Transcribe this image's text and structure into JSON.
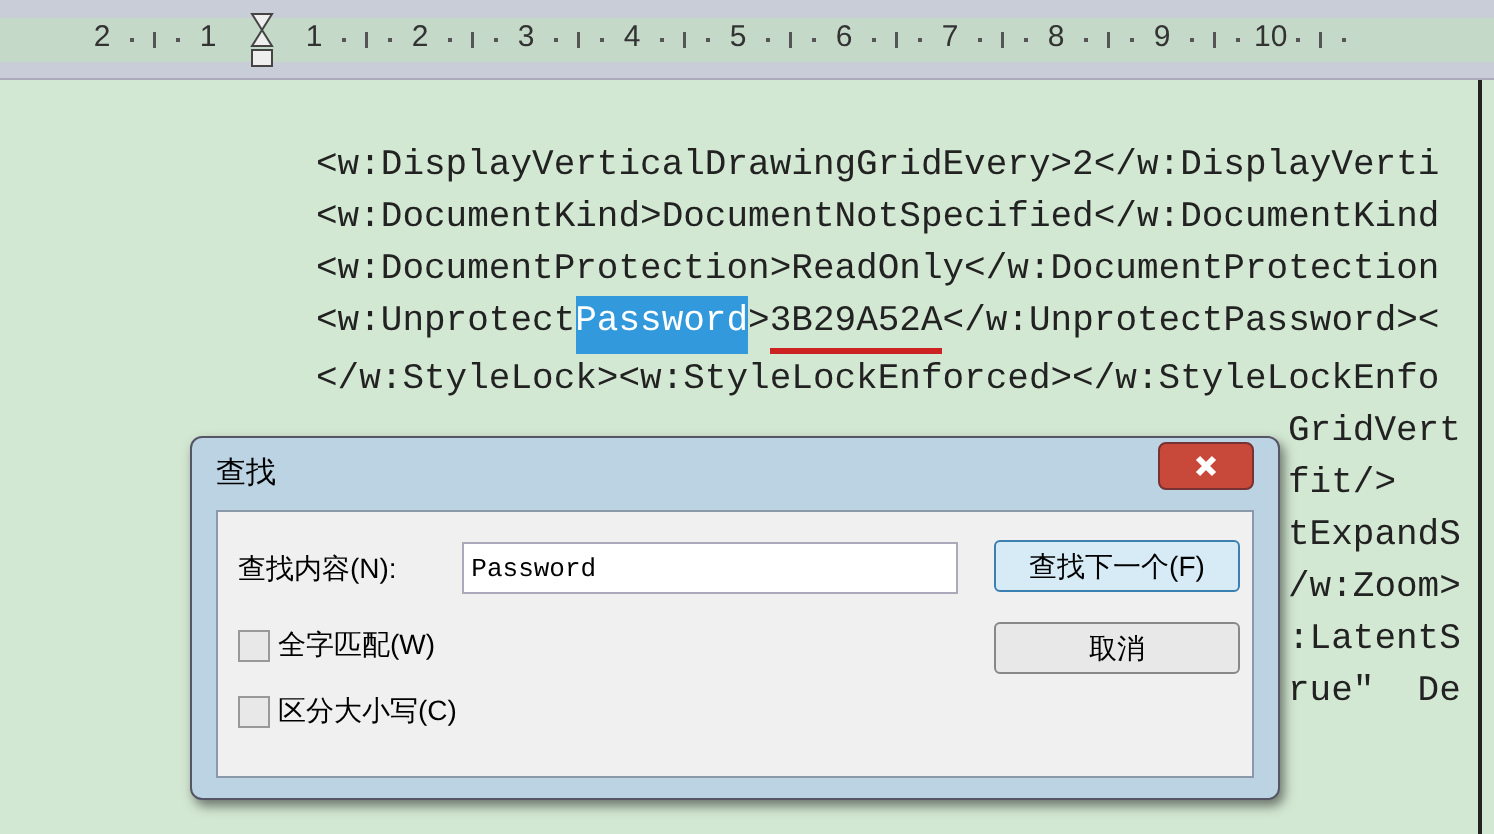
{
  "ruler": {
    "labels": [
      "2",
      "1",
      "1",
      "2",
      "3",
      "4",
      "5",
      "6",
      "7",
      "8",
      "9",
      "10"
    ]
  },
  "document": {
    "lines": [
      {
        "kind": "full",
        "segments": [
          {
            "kind": "plain",
            "text": "<w:DisplayVerticalDrawingGridEvery>2</w:DisplayVerti"
          }
        ]
      },
      {
        "kind": "full",
        "segments": [
          {
            "kind": "plain",
            "text": "<w:DocumentKind>DocumentNotSpecified</w:DocumentKind"
          }
        ]
      },
      {
        "kind": "full",
        "segments": [
          {
            "kind": "plain",
            "text": "<w:DocumentProtection>ReadOnly</w:DocumentProtection"
          }
        ]
      },
      {
        "kind": "full",
        "segments": [
          {
            "kind": "plain",
            "text": "<w:Unprotect"
          },
          {
            "kind": "highlight",
            "text": "Password"
          },
          {
            "kind": "plain",
            "text": ">"
          },
          {
            "kind": "underline",
            "text": "3B29A52A"
          },
          {
            "kind": "plain",
            "text": "</w:UnprotectPassword><"
          }
        ]
      },
      {
        "kind": "full",
        "segments": [
          {
            "kind": "plain",
            "text": "</w:StyleLock><w:StyleLockEnforced></w:StyleLockEnfo"
          }
        ]
      },
      {
        "kind": "tail",
        "segments": [
          {
            "kind": "plain",
            "text": "GridVert"
          }
        ]
      },
      {
        "kind": "tail",
        "segments": [
          {
            "kind": "plain",
            "text": "fit/>"
          }
        ]
      },
      {
        "kind": "tail",
        "segments": [
          {
            "kind": "plain",
            "text": "tExpandS"
          }
        ]
      },
      {
        "kind": "tail",
        "segments": [
          {
            "kind": "plain",
            "text": "/w:Zoom>"
          }
        ]
      },
      {
        "kind": "tail",
        "segments": [
          {
            "kind": "plain",
            "text": ":LatentS"
          }
        ]
      },
      {
        "kind": "tail",
        "segments": [
          {
            "kind": "plain",
            "text": "rue\"  De"
          }
        ]
      }
    ]
  },
  "dialog": {
    "title": "查找",
    "find_label": "查找内容(N):",
    "find_value": "Password",
    "options": [
      {
        "label": "全字匹配(W)",
        "checked": false
      },
      {
        "label": "区分大小写(C)",
        "checked": false
      }
    ],
    "buttons": [
      "查找下一个(F)",
      "取消"
    ]
  }
}
